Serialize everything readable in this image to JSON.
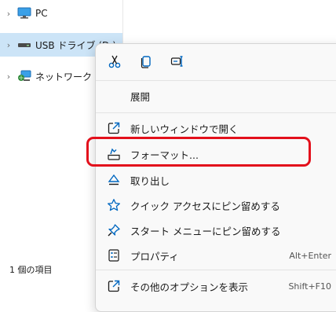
{
  "nav": {
    "items": [
      {
        "label": "PC",
        "icon": "monitor-icon"
      },
      {
        "label": "USB ドライブ (D:)",
        "icon": "usb-drive-icon",
        "selected": true
      },
      {
        "label": "ネットワーク",
        "icon": "network-icon"
      }
    ],
    "status": "1 個の項目"
  },
  "context_menu": {
    "quick_actions": [
      {
        "name": "cut",
        "icon": "scissors-icon"
      },
      {
        "name": "copy",
        "icon": "copy-icon"
      },
      {
        "name": "rename",
        "icon": "rename-icon"
      }
    ],
    "items": [
      {
        "label": "展開",
        "icon": ""
      },
      {
        "label": "新しいウィンドウで開く",
        "icon": "open-new-window-icon"
      },
      {
        "label": "フォーマット...",
        "icon": "format-drive-icon",
        "highlighted": true
      },
      {
        "label": "取り出し",
        "icon": "eject-icon"
      },
      {
        "label": "クイック アクセスにピン留めする",
        "icon": "star-icon"
      },
      {
        "label": "スタート メニューにピン留めする",
        "icon": "pin-icon"
      },
      {
        "label": "プロパティ",
        "icon": "properties-icon",
        "shortcut": "Alt+Enter"
      },
      {
        "label": "その他のオプションを表示",
        "icon": "more-options-icon",
        "shortcut": "Shift+F10"
      }
    ]
  },
  "colors": {
    "accent": "#0067c0",
    "selection": "#cce4f7",
    "highlight": "#e3101c"
  }
}
